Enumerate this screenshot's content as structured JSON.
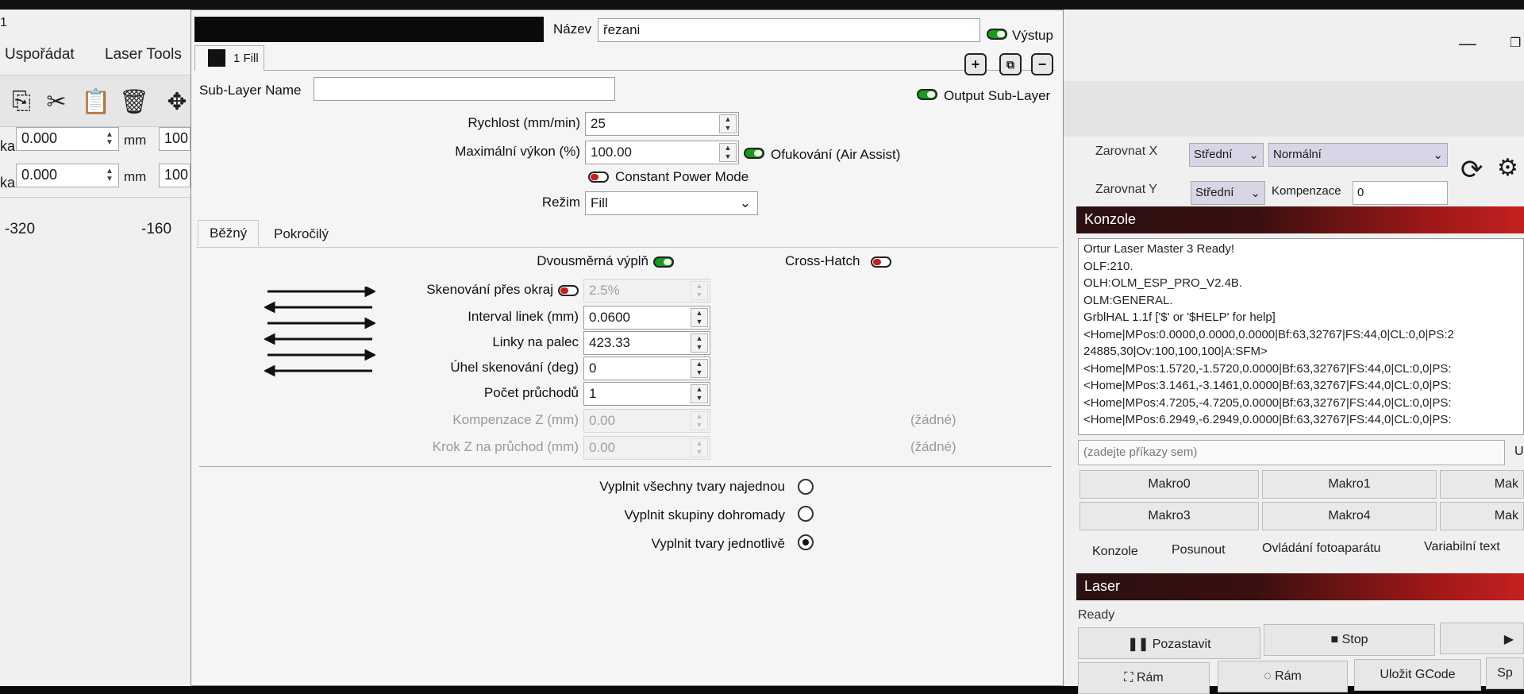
{
  "main_window": {
    "title_fragment": "1",
    "menu": [
      "Uspořádat",
      "Laser Tools"
    ],
    "left_fields": {
      "row1_prefix": "ka",
      "row1_value": "0.000",
      "row1_unit": "mm",
      "row1_extra": "100",
      "row2_prefix": "ka",
      "row2_value": "0.000",
      "row2_unit": "mm",
      "row2_extra": "100"
    },
    "ruler": [
      "-320",
      "-160"
    ],
    "align_row1": {
      "label": "Zarovnat X",
      "value": "Střední",
      "mode": "Normální"
    },
    "align_row2": {
      "label": "Zarovnat Y",
      "value": "Střední",
      "comp_label": "Kompenzace",
      "comp_value": "0"
    }
  },
  "console": {
    "header": "Konzole",
    "lines": [
      "Ortur Laser Master 3 Ready!",
      "OLF:210.",
      "OLH:OLM_ESP_PRO_V2.4B.",
      "OLM:GENERAL.",
      "GrblHAL 1.1f ['$' or '$HELP' for help]",
      "<Home|MPos:0.0000,0.0000,0.0000|Bf:63,32767|FS:44,0|CL:0,0|PS:2",
      "24885,30|Ov:100,100,100|A:SFM>",
      "<Home|MPos:1.5720,-1.5720,0.0000|Bf:63,32767|FS:44,0|CL:0,0|PS:",
      "<Home|MPos:3.1461,-3.1461,0.0000|Bf:63,32767|FS:44,0|CL:0,0|PS:",
      "<Home|MPos:4.7205,-4.7205,0.0000|Bf:63,32767|FS:44,0|CL:0,0|PS:",
      "<Home|MPos:6.2949,-6.2949,0.0000|Bf:63,32767|FS:44,0|CL:0,0|PS:"
    ],
    "command_placeholder": "(zadejte příkazy sem)",
    "command_right": "U",
    "macros": [
      "Makro0",
      "Makro1",
      "Mak",
      "Makro3",
      "Makro4",
      "Mak"
    ],
    "tabs": [
      "Konzole",
      "Posunout",
      "Ovládání fotoaparátu",
      "Variabilní text"
    ]
  },
  "laser": {
    "header": "Laser",
    "status": "Ready",
    "buttons": [
      "Pozastavit",
      "Stop",
      "Rám",
      "Rám",
      "Uložit GCode",
      "Sp"
    ]
  },
  "dialog": {
    "name_label": "Název",
    "name_value": "řezani",
    "output_label": "Výstup",
    "output_on": true,
    "sublayer_tab": "1 Fill",
    "sublayer_name_label": "Sub-Layer Name",
    "sublayer_name_value": "",
    "output_sublayer_label": "Output Sub-Layer",
    "speed_label": "Rychlost (mm/min)",
    "speed_value": "25",
    "power_label": "Maximální výkon (%)",
    "power_value": "100.00",
    "air_assist_label": "Ofukování (Air Assist)",
    "air_assist_on": true,
    "constant_power_label": "Constant Power Mode",
    "constant_power_on": false,
    "mode_label": "Režim",
    "mode_value": "Fill",
    "tabs": [
      "Běžný",
      "Pokročilý"
    ],
    "bidirectional_label": "Dvousměrná výplň",
    "bidirectional_on": true,
    "crosshatch_label": "Cross-Hatch",
    "crosshatch_on": false,
    "overscan_label": "Skenování přes okraj",
    "overscan_value": "2.5%",
    "overscan_on": false,
    "interval_label": "Interval linek (mm)",
    "interval_value": "0.0600",
    "lpi_label": "Linky na palec",
    "lpi_value": "423.33",
    "angle_label": "Úhel skenování (deg)",
    "angle_value": "0",
    "passes_label": "Počet průchodů",
    "passes_value": "1",
    "zoffset_label": "Kompenzace Z (mm)",
    "zoffset_value": "0.00",
    "zoffset_note": "(žádné)",
    "zstep_label": "Krok Z na průchod (mm)",
    "zstep_value": "0.00",
    "zstep_note": "(žádné)",
    "fill_options": [
      "Vyplnit všechny tvary najednou",
      "Vyplnit skupiny dohromady",
      "Vyplnit tvary jednotlivě"
    ],
    "fill_selected_index": 2,
    "colors": {
      "toggle_on": "#1a9a1a",
      "toggle_off": "#c81e1e",
      "header_red": "#c42020"
    }
  }
}
